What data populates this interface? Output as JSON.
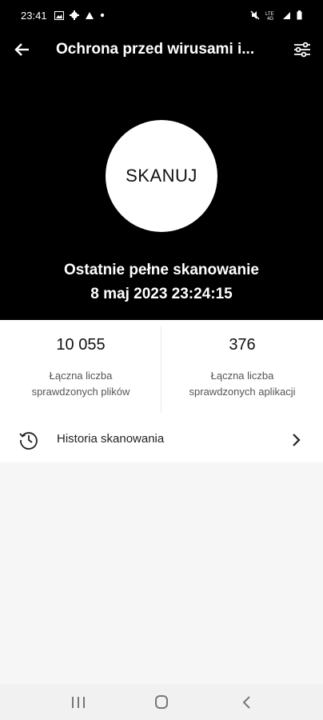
{
  "status_bar": {
    "time": "23:41",
    "left_icons": [
      "image-icon",
      "gear-icon",
      "triangle-icon",
      "dot-icon"
    ],
    "right_icons": [
      "mute-icon",
      "lte-icon",
      "signal-icon",
      "battery-icon"
    ]
  },
  "app_bar": {
    "title": "Ochrona przed wirusami i...",
    "back_icon": "arrow-left-icon",
    "settings_icon": "sliders-icon"
  },
  "hero": {
    "scan_button_label": "SKANUJ",
    "last_scan_label": "Ostatnie pełne skanowanie",
    "last_scan_datetime": "8 maj 2023 23:24:15"
  },
  "stats": [
    {
      "value": "10 055",
      "label_line1": "Łączna liczba",
      "label_line2": "sprawdzonych plików"
    },
    {
      "value": "376",
      "label_line1": "Łączna liczba",
      "label_line2": "sprawdzonych aplikacji"
    }
  ],
  "history": {
    "label": "Historia skanowania",
    "icon": "clock-history-icon"
  },
  "nav_bar": {
    "items": [
      "recent-apps-icon",
      "home-icon",
      "back-icon"
    ]
  },
  "colors": {
    "header_bg": "#000000",
    "page_bg": "#f6f6f6",
    "card_bg": "#ffffff"
  }
}
